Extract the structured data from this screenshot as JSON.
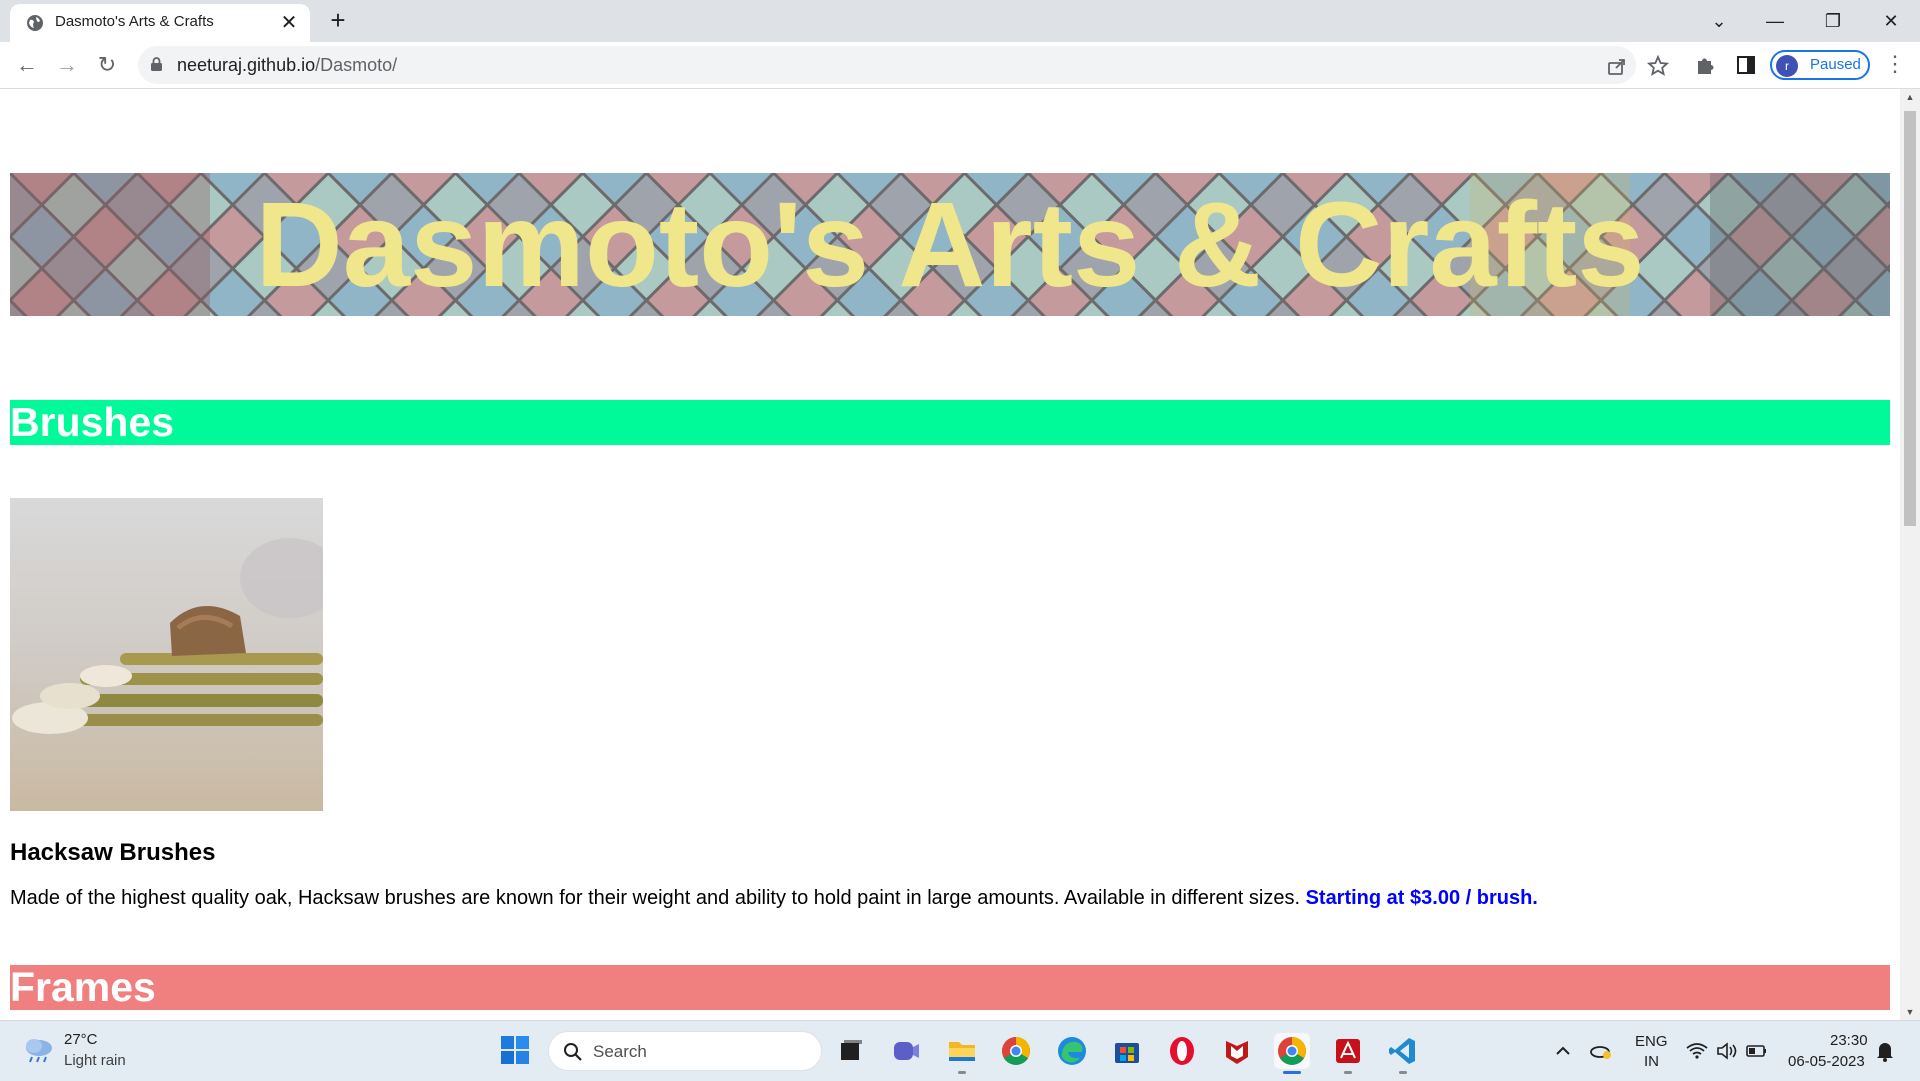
{
  "browser": {
    "tab_title": "Dasmoto's Arts & Crafts",
    "tab_close": "✕",
    "new_tab": "+",
    "url_host": "neeturaj.github.io",
    "url_path": "/Dasmoto/",
    "profile_initial": "r",
    "profile_status": "Paused",
    "nav": {
      "back": "←",
      "forward": "→",
      "reload": "↻"
    },
    "window": {
      "dropdown": "⌄",
      "minimize": "—",
      "maximize": "❐",
      "close": "✕"
    },
    "menu": "⋮"
  },
  "page": {
    "hero_title": "Dasmoto's Arts & Crafts",
    "sections": {
      "brushes": "Brushes",
      "frames": "Frames"
    },
    "product": {
      "name": "Hacksaw Brushes",
      "description": "Made of the highest quality oak, Hacksaw brushes are known for their weight and ability to hold paint in large amounts. Available in different sizes. ",
      "price": "Starting at $3.00 / brush."
    },
    "colors": {
      "hero_text": "#f0e68c",
      "brushes_bar": "#00fa9a",
      "frames_bar": "#f08080",
      "price": "#0000ff"
    }
  },
  "taskbar": {
    "weather_temp": "27°C",
    "weather_desc": "Light rain",
    "search_placeholder": "Search",
    "lang_line1": "ENG",
    "lang_line2": "IN",
    "time": "23:30",
    "date": "06-05-2023",
    "apps": [
      "start-icon",
      "search-icon",
      "task-view-icon",
      "teams-icon",
      "file-explorer-icon",
      "chrome-icon",
      "edge-icon",
      "store-icon",
      "opera-icon",
      "mcafee-icon",
      "chrome-icon",
      "acrobat-icon",
      "vscode-icon"
    ]
  }
}
